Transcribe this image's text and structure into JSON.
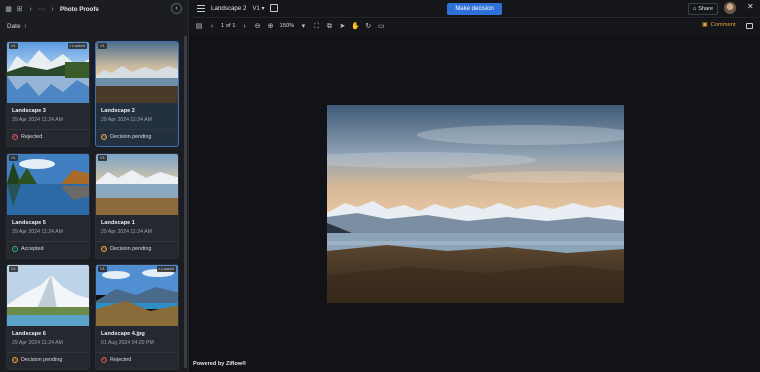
{
  "sidebar": {
    "breadcrumb_ellipsis": "···",
    "breadcrumb_title": "Photo Proofs",
    "sort_label": "Date",
    "cards": [
      {
        "name": "Landscape 3",
        "date": "29 Apr 2024 11:24 AM",
        "status": "Rejected",
        "version": "V1",
        "locked": "Locked"
      },
      {
        "name": "Landscape 2",
        "date": "29 Apr 2024 11:24 AM",
        "status": "Decision pending",
        "version": "V1",
        "locked": ""
      },
      {
        "name": "Landscape 5",
        "date": "29 Apr 2024 11:24 AM",
        "status": "Accepted",
        "version": "V1",
        "locked": ""
      },
      {
        "name": "Landscape 1",
        "date": "29 Apr 2024 11:24 AM",
        "status": "Decision pending",
        "version": "V1",
        "locked": ""
      },
      {
        "name": "Landscape 6",
        "date": "29 Apr 2024 11:24 AM",
        "status": "Decision pending",
        "version": "V1",
        "locked": ""
      },
      {
        "name": "Landscape 4.jpg",
        "date": "01 Aug 2024 04:20 PM",
        "status": "Rejected",
        "version": "V1",
        "locked": "Locked"
      }
    ]
  },
  "topbar": {
    "file_title": "Landscape 2",
    "version": "V1",
    "make_decision": "Make decision",
    "share": "Share"
  },
  "toolbar": {
    "page_indicator": "1 of 1",
    "zoom": "150%",
    "comment": "Comment"
  },
  "footer": {
    "powered_by": "Powered by Ziflow®"
  },
  "colors": {
    "accent": "#2f70d8",
    "rejected": "#e0535a",
    "pending": "#e8a33b",
    "accepted": "#37b26c"
  }
}
